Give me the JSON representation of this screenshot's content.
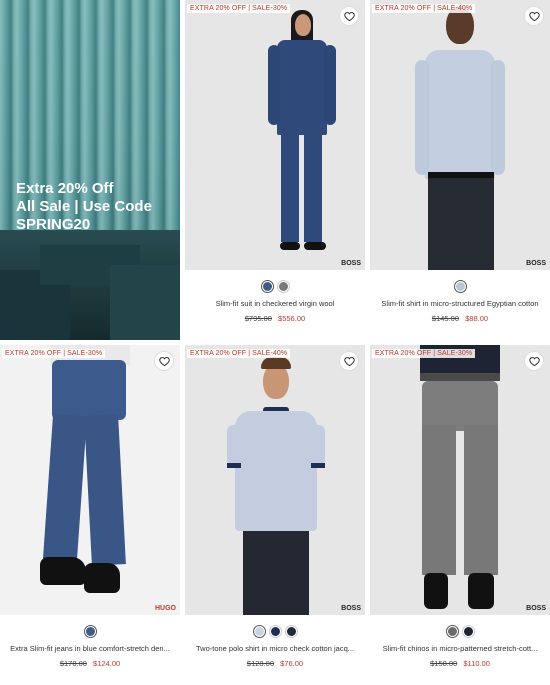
{
  "promo": {
    "line1": "Extra 20% Off",
    "line2": "All Sale | Use Code",
    "line3": "SPRING20"
  },
  "products": [
    {
      "badge": "EXTRA 20% OFF | SALE-30%",
      "brand": "BOSS",
      "name": "Slim-fit suit in checkered virgin wool",
      "old_price": "$795.00",
      "new_price": "$556.00",
      "swatches": [
        "#3c5a8a",
        "#7a7a7a"
      ]
    },
    {
      "badge": "EXTRA 20% OFF | SALE-40%",
      "brand": "BOSS",
      "name": "Slim-fit shirt in micro-structured Egyptian cotton",
      "old_price": "$145.00",
      "new_price": "$88.00",
      "swatches": [
        "#b8c6d8"
      ]
    },
    {
      "badge": "EXTRA 20% OFF | SALE-30%",
      "brand": "HUGO",
      "name": "Extra Slim-fit jeans in blue comfort-stretch den...",
      "old_price": "$178.00",
      "new_price": "$124.00",
      "swatches": [
        "#3f5b8a"
      ]
    },
    {
      "badge": "EXTRA 20% OFF | SALE-40%",
      "brand": "BOSS",
      "name": "Two-tone polo shirt in micro check cotton jacq...",
      "old_price": "$128.00",
      "new_price": "$76.00",
      "swatches": [
        "#c9d3e3",
        "#1f2f4f",
        "#222a3a"
      ]
    },
    {
      "badge": "EXTRA 20% OFF | SALE-30%",
      "brand": "BOSS",
      "name": "Slim-fit chinos in micro-patterned stretch-cott...",
      "old_price": "$158.00",
      "new_price": "$110.00",
      "swatches": [
        "#6b6b6b",
        "#1e2433"
      ]
    }
  ]
}
